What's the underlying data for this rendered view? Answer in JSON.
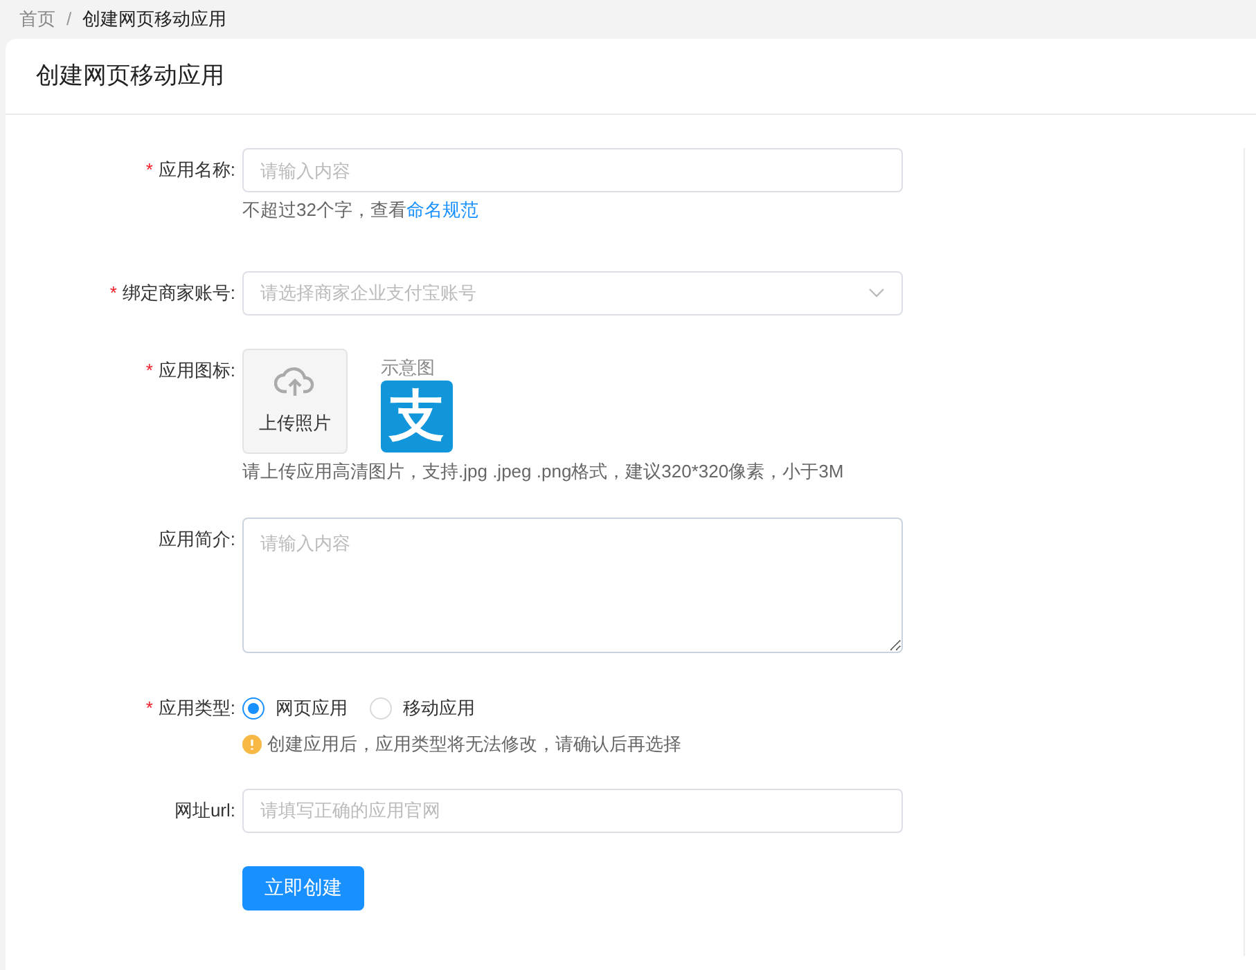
{
  "breadcrumb": [
    {
      "label": "首页",
      "current": false
    },
    {
      "label": "/",
      "kind": "separator"
    },
    {
      "label": "创建网页移动应用",
      "current": true
    }
  ],
  "title": "创建网页移动应用",
  "fields": [
    {
      "kind": "input",
      "required_mark": "*",
      "label": "应用名称:",
      "placeholder": "请输入内容",
      "hint": "不超过32个字，查看",
      "hint_link": "命名规范"
    },
    {
      "kind": "select",
      "required_mark": "*",
      "label": "绑定商家账号:",
      "placeholder": "请选择商家企业支付宝账号"
    },
    {
      "kind": "upload",
      "required_mark": "*",
      "label": "应用图标:",
      "upload_label": "上传照片",
      "sample_caption": "示意图",
      "sample_logo": "支",
      "hint": "请上传应用高清图片，支持.jpg .jpeg .png格式，建议320*320像素，小于3M"
    },
    {
      "kind": "textarea",
      "label": "应用简介:",
      "placeholder": "请输入内容"
    },
    {
      "kind": "radio",
      "required_mark": "*",
      "label": "应用类型:",
      "options": [
        {
          "label": "网页应用",
          "selected": true
        },
        {
          "label": "移动应用",
          "selected": false
        }
      ],
      "warning": "创建应用后，应用类型将无法修改，请确认后再选择"
    },
    {
      "kind": "input",
      "label": "网址url:",
      "placeholder": "请填写正确的应用官网"
    }
  ],
  "submit": "立即创建"
}
